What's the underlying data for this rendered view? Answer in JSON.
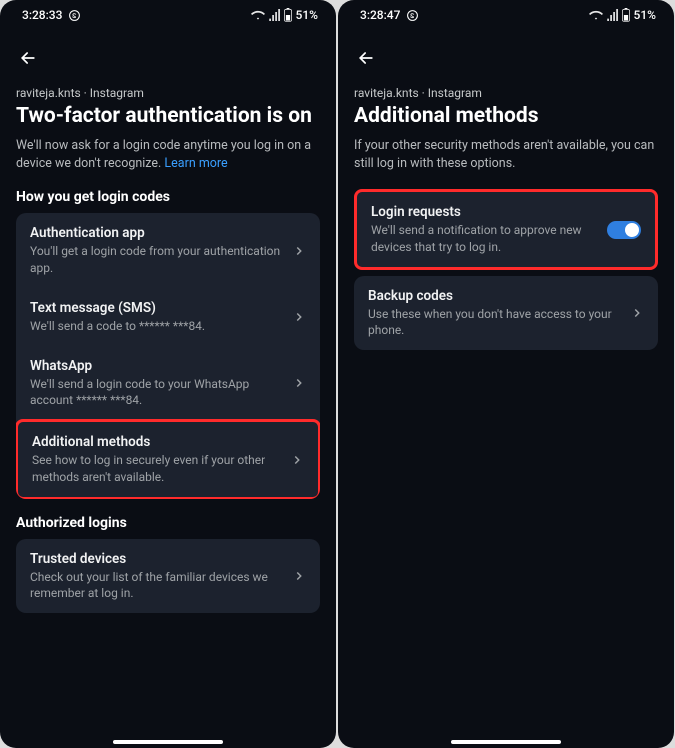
{
  "statusbar": {
    "time_left": "3:28:33",
    "time_right": "3:28:47",
    "battery": "51%"
  },
  "left": {
    "breadcrumb": "raviteja.knts · Instagram",
    "title": "Two-factor authentication is on",
    "subtitle_pre": "We'll now ask for a login code anytime you log in on a device we don't recognize. ",
    "learn_more": "Learn more",
    "section1_title": "How you get login codes",
    "items": [
      {
        "title": "Authentication app",
        "desc": "You'll get a login code from your authentication app."
      },
      {
        "title": "Text message (SMS)",
        "desc": "We'll send a code to ****** ***84."
      },
      {
        "title": "WhatsApp",
        "desc": "We'll send a login code to your WhatsApp account ****** ***84."
      },
      {
        "title": "Additional methods",
        "desc": "See how to log in securely even if your other methods aren't available."
      }
    ],
    "section2_title": "Authorized logins",
    "trusted": {
      "title": "Trusted devices",
      "desc": "Check out your list of the familiar devices we remember at log in."
    }
  },
  "right": {
    "breadcrumb": "raviteja.knts · Instagram",
    "title": "Additional methods",
    "subtitle": "If your other security methods aren't available, you can still log in with these options.",
    "login_requests": {
      "title": "Login requests",
      "desc": "We'll send a notification to approve new devices that try to log in."
    },
    "backup_codes": {
      "title": "Backup codes",
      "desc": "Use these when you don't have access to your phone."
    }
  }
}
